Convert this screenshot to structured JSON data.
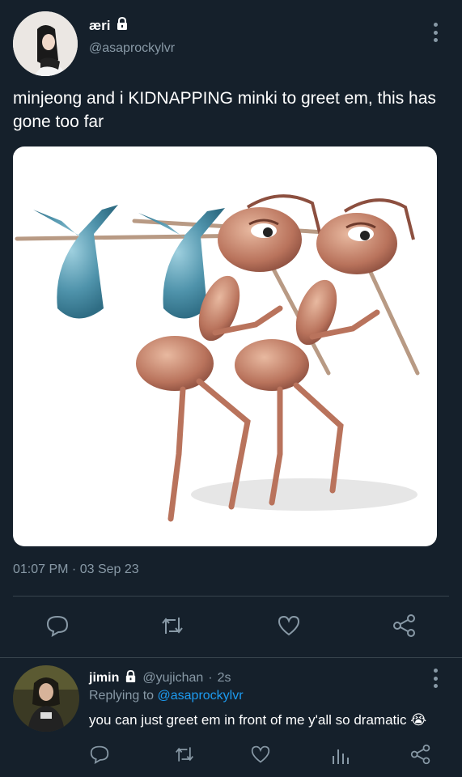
{
  "tweet": {
    "display_name": "æri",
    "handle": "@asaprockylvr",
    "text": "minjeong and i KIDNAPPING minki to greet em, this has gone too far",
    "timestamp": "01:07 PM · 03 Sep 23",
    "actions": [
      "reply-icon",
      "retweet-icon",
      "like-icon",
      "share-icon"
    ]
  },
  "reply": {
    "display_name": "jimin",
    "handle": "@yujichan",
    "time_sep": "·",
    "time": "2s",
    "replying_prefix": "Replying to",
    "replying_to": "@asaprockylvr",
    "text": "you can just greet em in front of me y'all so dramatic 😭",
    "actions": [
      "reply-icon",
      "retweet-icon",
      "like-icon",
      "analytics-icon",
      "share-icon"
    ]
  },
  "colors": {
    "background": "#15202b",
    "secondary_text": "#8899a6",
    "link": "#1d9bf0",
    "divider": "#38444d"
  }
}
